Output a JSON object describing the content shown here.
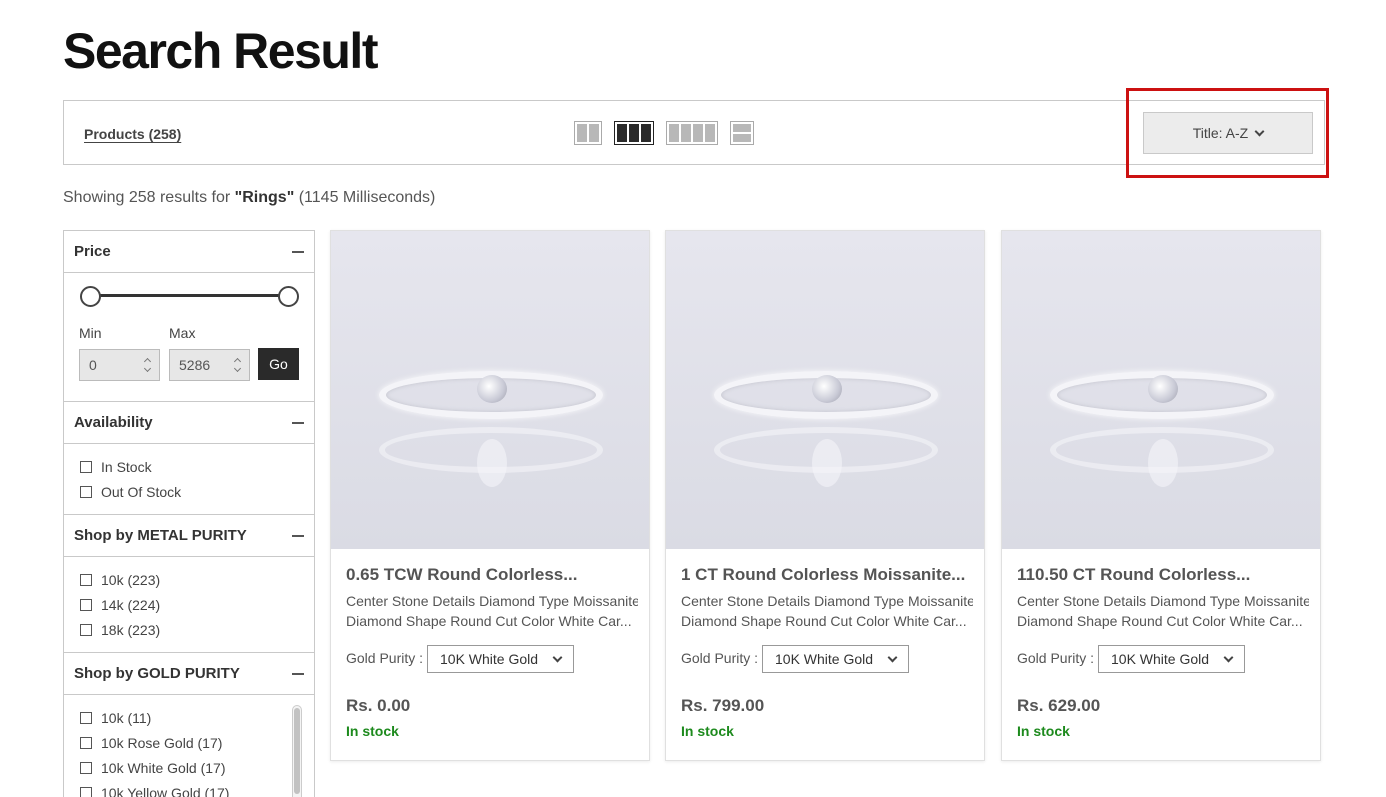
{
  "page_title": "Search Result",
  "toolbar": {
    "products_label": "Products (258)",
    "views": [
      "grid-2",
      "grid-3",
      "grid-4",
      "list"
    ],
    "active_view": "grid-3",
    "sort_label": "Title: A-Z"
  },
  "results": {
    "prefix": "Showing 258 results for ",
    "query": "\"Rings\"",
    "suffix": " (1145 Milliseconds)"
  },
  "filters": {
    "price": {
      "title": "Price",
      "min_label": "Min",
      "max_label": "Max",
      "min_value": "0",
      "max_value": "5286",
      "go_label": "Go"
    },
    "availability": {
      "title": "Availability",
      "options": [
        "In Stock",
        "Out Of Stock"
      ]
    },
    "metal_purity": {
      "title": "Shop by METAL PURITY",
      "options": [
        "10k (223)",
        "14k (224)",
        "18k (223)"
      ]
    },
    "gold_purity": {
      "title": "Shop by GOLD PURITY",
      "options": [
        "10k (11)",
        "10k Rose Gold (17)",
        "10k White Gold (17)",
        "10k Yellow Gold (17)"
      ]
    }
  },
  "products": [
    {
      "title": "0.65 TCW Round Colorless...",
      "desc_line1": "Center Stone Details Diamond Type Moissanite",
      "desc_line2": "Diamond Shape Round Cut Color White Car...",
      "option_label": "Gold Purity :",
      "option_value": "10K White Gold",
      "price": "Rs. 0.00",
      "stock": "In stock"
    },
    {
      "title": "1 CT Round Colorless Moissanite...",
      "desc_line1": "Center Stone Details Diamond Type Moissanite",
      "desc_line2": "Diamond Shape Round Cut Color White Car...",
      "option_label": "Gold Purity :",
      "option_value": "10K White Gold",
      "price": "Rs. 799.00",
      "stock": "In stock"
    },
    {
      "title": "110.50 CT Round Colorless...",
      "desc_line1": "Center Stone Details Diamond Type Moissanite",
      "desc_line2": "Diamond Shape Round Cut Color White Car...",
      "option_label": "Gold Purity :",
      "option_value": "10K White Gold",
      "price": "Rs. 629.00",
      "stock": "In stock"
    }
  ],
  "colors": {
    "accent_dark": "#2a2a2a",
    "stock_green": "#1d8a1d",
    "highlight_red": "#cc1111"
  }
}
